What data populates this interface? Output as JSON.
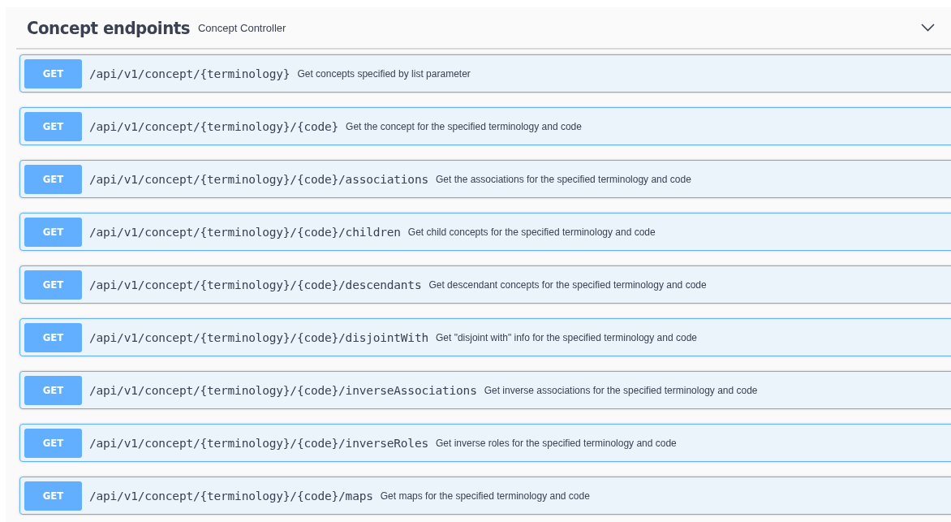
{
  "section": {
    "title": "Concept endpoints",
    "description": "Concept Controller",
    "expanded": true
  },
  "operations": [
    {
      "method": "GET",
      "path": "/api/v1/concept/{terminology}",
      "summary": "Get concepts specified by list parameter"
    },
    {
      "method": "GET",
      "path": "/api/v1/concept/{terminology}/{code}",
      "summary": "Get the concept for the specified terminology and code"
    },
    {
      "method": "GET",
      "path": "/api/v1/concept/{terminology}/{code}/associations",
      "summary": "Get the associations for the specified terminology and code"
    },
    {
      "method": "GET",
      "path": "/api/v1/concept/{terminology}/{code}/children",
      "summary": "Get child concepts for the specified terminology and code"
    },
    {
      "method": "GET",
      "path": "/api/v1/concept/{terminology}/{code}/descendants",
      "summary": "Get descendant concepts for the specified terminology and code"
    },
    {
      "method": "GET",
      "path": "/api/v1/concept/{terminology}/{code}/disjointWith",
      "summary": "Get \"disjoint with\" info for the specified terminology and code"
    },
    {
      "method": "GET",
      "path": "/api/v1/concept/{terminology}/{code}/inverseAssociations",
      "summary": "Get inverse associations for the specified terminology and code"
    },
    {
      "method": "GET",
      "path": "/api/v1/concept/{terminology}/{code}/inverseRoles",
      "summary": "Get inverse roles for the specified terminology and code"
    },
    {
      "method": "GET",
      "path": "/api/v1/concept/{terminology}/{code}/maps",
      "summary": "Get maps for the specified terminology and code"
    }
  ]
}
